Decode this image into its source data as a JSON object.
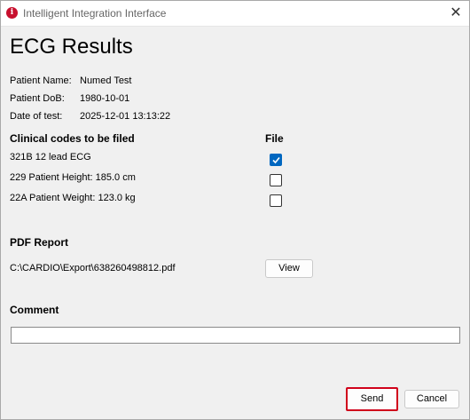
{
  "window": {
    "title": "Intelligent Integration Interface",
    "app_icon_glyph": "i",
    "close_glyph": "✕"
  },
  "page_title": "ECG Results",
  "patient": {
    "name_label": "Patient Name:",
    "name_value": "Numed Test",
    "dob_label": "Patient DoB:",
    "dob_value": "1980-10-01",
    "date_label": "Date of test:",
    "date_value": "2025-12-01 13:13:22"
  },
  "codes": {
    "header": "Clinical codes to be filed",
    "file_header": "File",
    "items": [
      {
        "label": "321B 12 lead ECG",
        "checked": true
      },
      {
        "label": "229 Patient Height: 185.0 cm",
        "checked": false
      },
      {
        "label": "22A Patient Weight: 123.0 kg",
        "checked": false
      }
    ]
  },
  "pdf": {
    "header": "PDF Report",
    "path": "C:\\CARDIO\\Export\\638260498812.pdf",
    "view_label": "View"
  },
  "comment": {
    "header": "Comment",
    "value": ""
  },
  "actions": {
    "send_label": "Send",
    "cancel_label": "Cancel"
  },
  "colors": {
    "checkbox_accent": "#0067c0",
    "send_highlight": "#d0021b",
    "app_icon": "#c8102e"
  }
}
